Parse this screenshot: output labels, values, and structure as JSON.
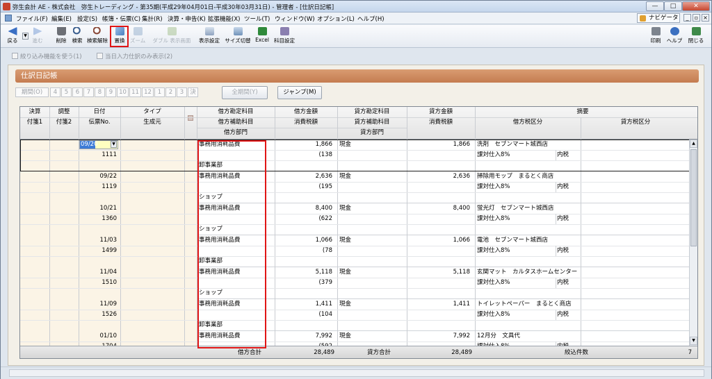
{
  "window": {
    "title": "弥生会計 AE - 株式会社　弥生トレーディング - 第35期(平成29年04月01日-平成30年03月31日) - 管理者 - [仕訳日記帳]",
    "navigator": "ナビゲータ"
  },
  "menu": [
    "ファイル(F)",
    "編集(E)",
    "設定(S)",
    "帳簿・伝票(C)",
    "集計(R)",
    "決算・申告(K)",
    "拡張機能(X)",
    "ツール(T)",
    "ウィンドウ(W)",
    "オプション(L)",
    "ヘルプ(H)"
  ],
  "toolbar": {
    "back": "戻る",
    "forward": "進む",
    "delete": "削除",
    "search": "検索",
    "search_clear": "検索解除",
    "replace": "置換",
    "zoom": "ズーム",
    "item_unfold": "ダブル 表示画面",
    "display_settings": "表示設定",
    "size_toggle": "サイズ切替",
    "excel": "Excel",
    "account_settings": "科目設定",
    "print": "印刷",
    "help": "ヘルプ",
    "close": "閉じる",
    "colors": {
      "replace_highlight": "#e01515"
    }
  },
  "options": {
    "narrow_func": "絞り込み機能を使う(1)",
    "today_only": "当日入力仕訳のみ表示(2)"
  },
  "panel": {
    "title": "仕訳日記帳",
    "period_label": "期間(O)",
    "months": [
      "4",
      "5",
      "6",
      "7",
      "8",
      "9",
      "10",
      "11",
      "12",
      "1",
      "2",
      "3",
      "決"
    ],
    "all_period": "全期間(Y)",
    "jump": "ジャンプ(M)"
  },
  "grid": {
    "headers": {
      "kessan": "決算",
      "choseki": "調整",
      "date": "日付",
      "type": "タイプ",
      "debit_account": "借方勘定科目",
      "debit_amount": "借方金額",
      "credit_account": "貸方勘定科目",
      "credit_amount": "貸方金額",
      "memo": "摘要",
      "fusen1": "付箋1",
      "fusen2": "付箋2",
      "voucher_no": "伝票No.",
      "origin": "生成元",
      "debit_sub": "借方補助科目",
      "debit_tax": "消費税額",
      "credit_sub": "貸方補助科目",
      "credit_tax": "消費税額",
      "debit_tax_class": "借方税区分",
      "credit_tax_class": "貸方税区分",
      "debit_dept": "借方部門",
      "credit_dept": "貸方部門"
    },
    "rows": [
      {
        "date": "09/20",
        "no": "1111",
        "debit": "事務用消耗品費",
        "amount": "1,866",
        "tax": "(138",
        "dept": "卸事業部",
        "credit": "現金",
        "credit_amount": "1,866",
        "memo": "洗剤　セブンマート城西店",
        "tax_class": "課対仕入8%",
        "incl": "内税"
      },
      {
        "date": "09/22",
        "no": "1119",
        "debit": "事務用消耗品費",
        "amount": "2,636",
        "tax": "(195",
        "dept": "ショップ",
        "credit": "現金",
        "credit_amount": "2,636",
        "memo": "掃除用モップ　まるとく商店",
        "tax_class": "課対仕入8%",
        "incl": "内税"
      },
      {
        "date": "10/21",
        "no": "1360",
        "debit": "事務用消耗品費",
        "amount": "8,400",
        "tax": "(622",
        "dept": "ショップ",
        "credit": "現金",
        "credit_amount": "8,400",
        "memo": "蛍光灯　セブンマート城西店",
        "tax_class": "課対仕入8%",
        "incl": "内税"
      },
      {
        "date": "11/03",
        "no": "1499",
        "debit": "事務用消耗品費",
        "amount": "1,066",
        "tax": "(78",
        "dept": "卸事業部",
        "credit": "現金",
        "credit_amount": "1,066",
        "memo": "電池　セブンマート城西店",
        "tax_class": "課対仕入8%",
        "incl": "内税"
      },
      {
        "date": "11/04",
        "no": "1510",
        "debit": "事務用消耗品費",
        "amount": "5,118",
        "tax": "(379",
        "dept": "ショップ",
        "credit": "現金",
        "credit_amount": "5,118",
        "memo": "玄関マット　カルタスホームセンター",
        "tax_class": "課対仕入8%",
        "incl": "内税"
      },
      {
        "date": "11/09",
        "no": "1526",
        "debit": "事務用消耗品費",
        "amount": "1,411",
        "tax": "(104",
        "dept": "卸事業部",
        "credit": "現金",
        "credit_amount": "1,411",
        "memo": "トイレットペーパー　まるとく商店",
        "tax_class": "課対仕入8%",
        "incl": "内税"
      },
      {
        "date": "01/10",
        "no": "1704",
        "debit": "事務用消耗品費",
        "amount": "7,992",
        "tax": "(592",
        "dept": "",
        "credit": "現金",
        "credit_amount": "7,992",
        "memo": "12月分　文具代",
        "tax_class": "課対仕入8%",
        "incl": "内税"
      }
    ],
    "footer": {
      "debit_total_label": "借方合計",
      "debit_total": "28,489",
      "credit_total_label": "貸方合計",
      "credit_total": "28,489",
      "count_label": "絞込件数",
      "count": "7"
    }
  }
}
